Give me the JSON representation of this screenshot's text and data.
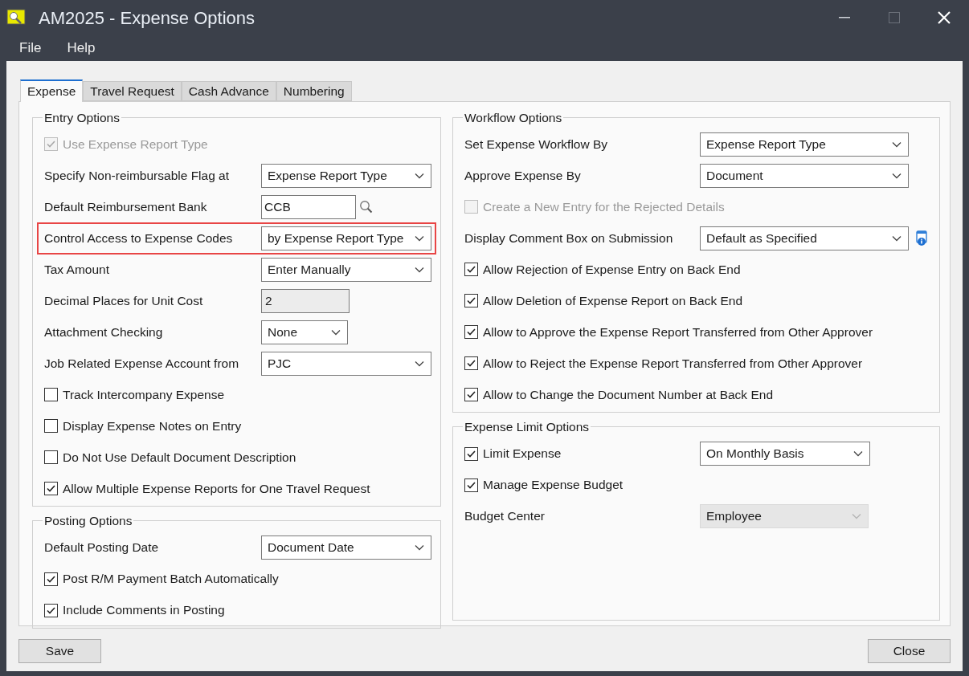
{
  "window": {
    "title": "AM2025 - Expense Options"
  },
  "menu": [
    "File",
    "Help"
  ],
  "tabs": [
    {
      "label": "Expense",
      "selected": true
    },
    {
      "label": "Travel Request",
      "selected": false
    },
    {
      "label": "Cash Advance",
      "selected": false
    },
    {
      "label": "Numbering",
      "selected": false
    }
  ],
  "left_groups": [
    {
      "title": "Entry Options",
      "rows": [
        {
          "kind": "checkbox",
          "label": "Use Expense Report Type",
          "checked": true,
          "disabled": true
        },
        {
          "kind": "select",
          "label": "Specify Non-reimbursable Flag at",
          "value": "Expense Report Type",
          "disabled": false
        },
        {
          "kind": "lookup",
          "label": "Default Reimbursement Bank",
          "value": "CCB"
        },
        {
          "kind": "select",
          "label": "Control Access to Expense Codes",
          "value": "by Expense Report Type",
          "disabled": false,
          "highlighted": true
        },
        {
          "kind": "select",
          "label": "Tax Amount",
          "value": "Enter Manually",
          "disabled": false
        },
        {
          "kind": "readonly",
          "label": "Decimal Places for Unit Cost",
          "value": "2"
        },
        {
          "kind": "select_short",
          "label": "Attachment Checking",
          "value": "None",
          "disabled": false
        },
        {
          "kind": "select",
          "label": "Job Related Expense Account from",
          "value": "PJC",
          "disabled": false
        },
        {
          "kind": "checkbox",
          "label": "Track Intercompany Expense",
          "checked": false,
          "disabled": false
        },
        {
          "kind": "checkbox",
          "label": "Display Expense Notes on Entry",
          "checked": false,
          "disabled": false
        },
        {
          "kind": "checkbox",
          "label": "Do Not Use Default Document Description",
          "checked": false,
          "disabled": false
        },
        {
          "kind": "checkbox",
          "label": "Allow Multiple Expense Reports for One Travel Request",
          "checked": true,
          "disabled": false
        }
      ]
    },
    {
      "title": "Posting Options",
      "rows": [
        {
          "kind": "select",
          "label": "Default Posting Date",
          "value": "Document Date",
          "disabled": false
        },
        {
          "kind": "checkbox",
          "label": "Post R/M Payment Batch Automatically",
          "checked": true,
          "disabled": false
        },
        {
          "kind": "checkbox",
          "label": "Include Comments in Posting",
          "checked": true,
          "disabled": false
        }
      ]
    }
  ],
  "right_groups": [
    {
      "title": "Workflow Options",
      "rows": [
        {
          "kind": "select",
          "label": "Set Expense Workflow By",
          "value": "Expense Report Type",
          "disabled": false
        },
        {
          "kind": "select",
          "label": "Approve Expense By",
          "value": "Document",
          "disabled": false
        },
        {
          "kind": "checkbox",
          "label": "Create a New Entry for the Rejected Details",
          "checked": false,
          "disabled": true
        },
        {
          "kind": "select_info",
          "label": "Display Comment Box on Submission",
          "value": "Default as Specified",
          "disabled": false
        },
        {
          "kind": "checkbox",
          "label": "Allow Rejection of Expense Entry on Back End",
          "checked": true,
          "disabled": false
        },
        {
          "kind": "checkbox",
          "label": "Allow Deletion of Expense Report on Back End",
          "checked": true,
          "disabled": false
        },
        {
          "kind": "checkbox",
          "label": "Allow to Approve the Expense Report Transferred from Other Approver",
          "checked": true,
          "disabled": false
        },
        {
          "kind": "checkbox",
          "label": "Allow to Reject the Expense Report Transferred from Other Approver",
          "checked": true,
          "disabled": false
        },
        {
          "kind": "checkbox",
          "label": "Allow to Change the Document Number at Back End",
          "checked": true,
          "disabled": false
        }
      ]
    },
    {
      "title": "Expense Limit Options",
      "rows": [
        {
          "kind": "checkbox_select",
          "label": "Limit Expense",
          "checked": true,
          "disabled": false,
          "value": "On Monthly Basis"
        },
        {
          "kind": "checkbox",
          "label": "Manage Expense Budget",
          "checked": true,
          "disabled": false
        },
        {
          "kind": "select_short",
          "label": "Budget Center",
          "value": "Employee",
          "disabled": true
        }
      ]
    }
  ],
  "buttons": {
    "save": "Save",
    "close": "Close"
  }
}
